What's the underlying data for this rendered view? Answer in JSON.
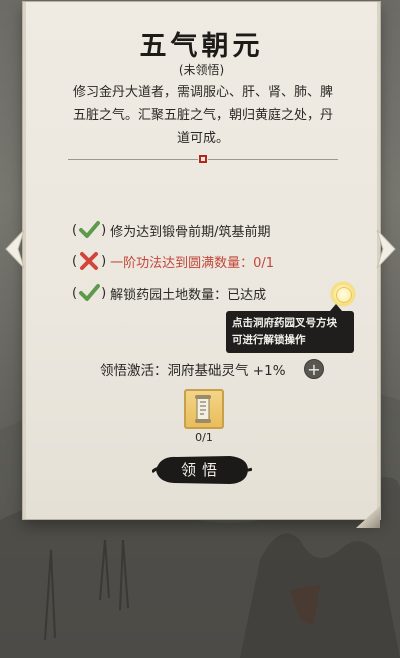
{
  "technique": {
    "title": "五气朝元",
    "status": "(未领悟)",
    "description_lines": [
      "修习金丹大道者，需调服心、肝、肾、肺、脾",
      "五脏之气。汇聚五脏之气，朝归黄庭之处，丹",
      "道可成。"
    ]
  },
  "conditions": [
    {
      "met": true,
      "text": "修为达到锻骨前期/筑基前期",
      "open": "(",
      "close": ")"
    },
    {
      "met": false,
      "text": "一阶功法达到圆满数量：0/1",
      "open": "(",
      "close": ")"
    },
    {
      "met": true,
      "text": "解锁药园土地数量：已达成",
      "open": "(",
      "close": ")"
    }
  ],
  "tooltip": {
    "line1": "点击洞府药园叉号方块",
    "line2": "可进行解锁操作"
  },
  "activation": {
    "text": "领悟激活：洞府基础灵气 +1%",
    "plus_label": "+"
  },
  "item": {
    "icon": "scroll-icon",
    "count": "0/1"
  },
  "button": {
    "label": "领悟"
  },
  "colors": {
    "panel": "#efebe3",
    "fail_text": "#c2473a",
    "check_green": "#5d9a4a",
    "cross_red": "#d2453a",
    "item_gold": "#e9bd5c"
  }
}
